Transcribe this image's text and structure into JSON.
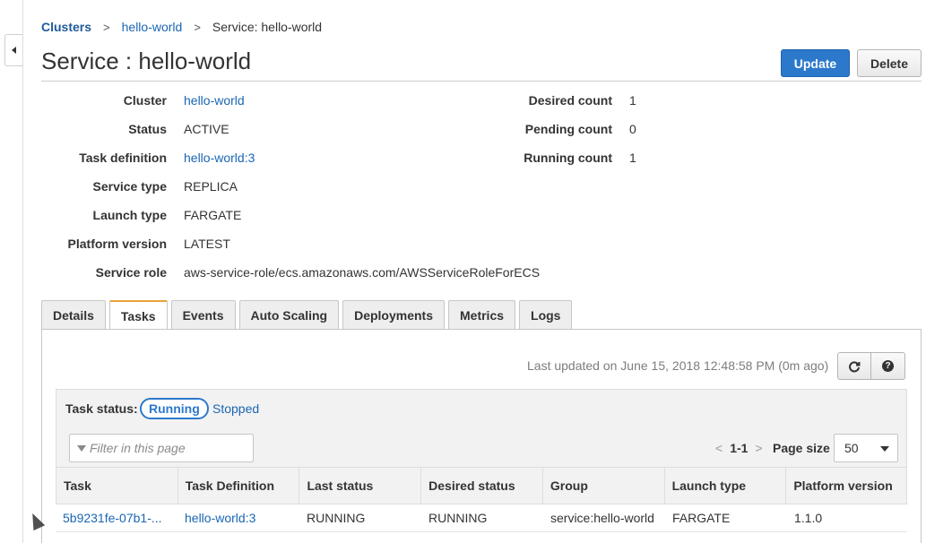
{
  "breadcrumb": {
    "clusters": "Clusters",
    "cluster": "hello-world",
    "current": "Service: hello-world",
    "separator": ">"
  },
  "header": {
    "title": "Service : hello-world",
    "update_label": "Update",
    "delete_label": "Delete"
  },
  "summary_left": [
    {
      "key": "Cluster",
      "value": "hello-world"
    },
    {
      "key": "Status",
      "value": "ACTIVE"
    },
    {
      "key": "Task definition",
      "value": "hello-world:3"
    },
    {
      "key": "Service type",
      "value": "REPLICA"
    },
    {
      "key": "Launch type",
      "value": "FARGATE"
    },
    {
      "key": "Platform version",
      "value": "LATEST"
    },
    {
      "key": "Service role",
      "value": "aws-service-role/ecs.amazonaws.com/AWSServiceRoleForECS"
    }
  ],
  "summary_right": [
    {
      "key": "Desired count",
      "value": "1"
    },
    {
      "key": "Pending count",
      "value": "0"
    },
    {
      "key": "Running count",
      "value": "1"
    }
  ],
  "tabs": [
    {
      "label": "Details"
    },
    {
      "label": "Tasks"
    },
    {
      "label": "Events"
    },
    {
      "label": "Auto Scaling"
    },
    {
      "label": "Deployments"
    },
    {
      "label": "Metrics"
    },
    {
      "label": "Logs"
    }
  ],
  "active_tab": "Tasks",
  "tasks": {
    "last_updated": "Last updated on June 15, 2018 12:48:58 PM (0m ago)",
    "status_label": "Task status:",
    "running_label": "Running",
    "stopped_label": "Stopped",
    "filter_placeholder": "Filter in this page",
    "prev": "<",
    "next": ">",
    "range": "1-1",
    "page_size_label": "Page size",
    "page_size": "50",
    "help_symbol": "?",
    "columns": [
      "Task",
      "Task Definition",
      "Last status",
      "Desired status",
      "Group",
      "Launch type",
      "Platform version"
    ],
    "rows": [
      [
        "5b9231fe-07b1-...",
        "hello-world:3",
        "RUNNING",
        "RUNNING",
        "service:hello-world",
        "FARGATE",
        "1.1.0"
      ]
    ]
  },
  "colors": {
    "accent": "#2c79cc",
    "link": "#1a66b3",
    "tab_active": "#e9a13b"
  }
}
